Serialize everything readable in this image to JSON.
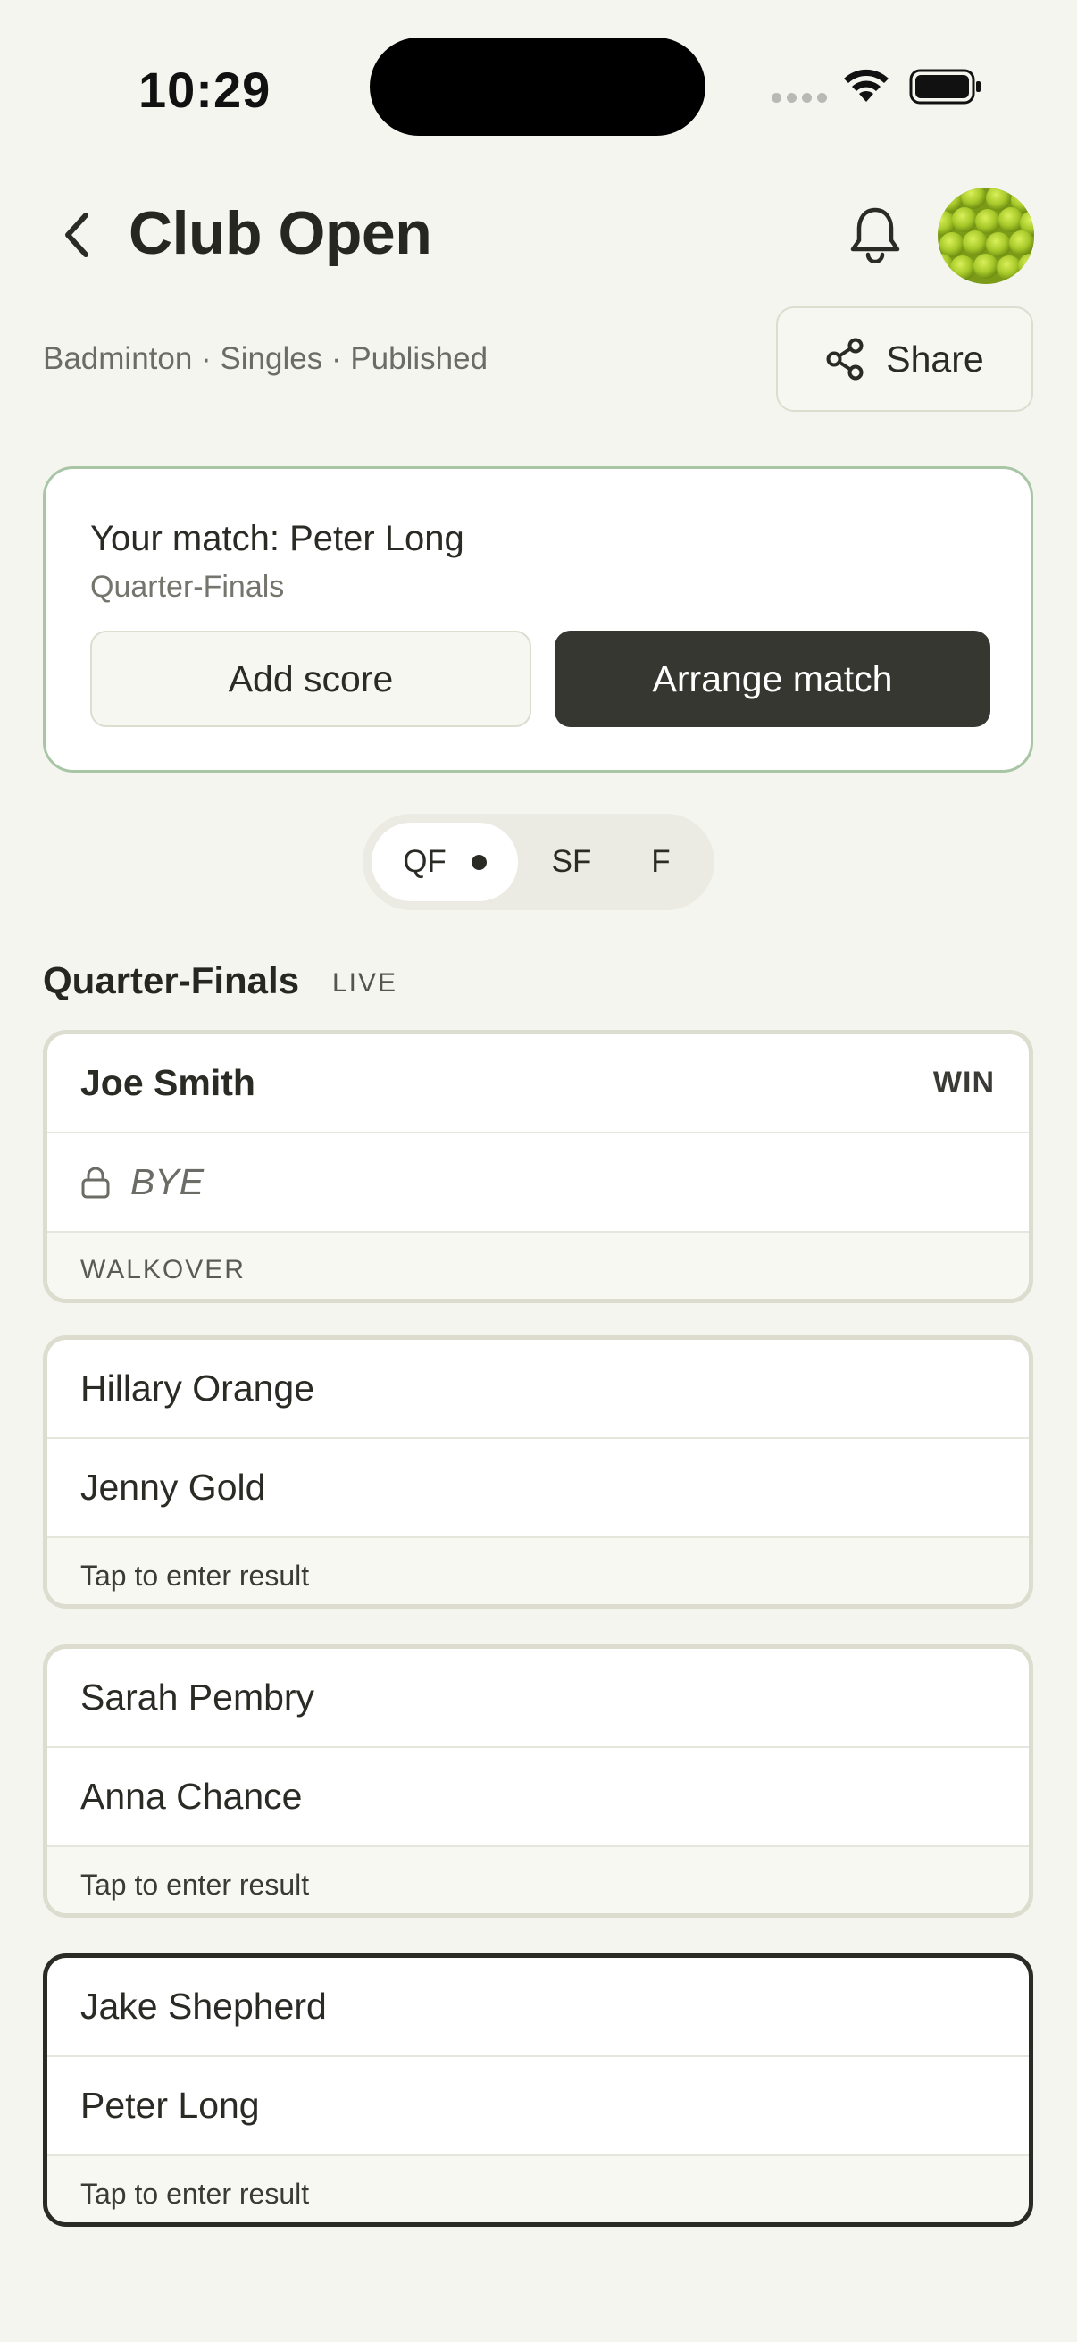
{
  "status_bar": {
    "time": "10:29"
  },
  "header": {
    "title": "Club Open",
    "meta": "Badminton · Singles · Published",
    "share_label": "Share"
  },
  "your_match": {
    "title": "Your match: Peter Long",
    "round": "Quarter-Finals",
    "add_score_label": "Add score",
    "arrange_label": "Arrange match"
  },
  "rounds_tabs": [
    {
      "label": "QF",
      "selected": true,
      "has_dot": true
    },
    {
      "label": "SF",
      "selected": false
    },
    {
      "label": "F",
      "selected": false
    }
  ],
  "section": {
    "title": "Quarter-Finals",
    "badge": "LIVE"
  },
  "matches": [
    {
      "player1": "Joe Smith",
      "player1_result": "WIN",
      "player2": "BYE",
      "footer": "WALKOVER"
    },
    {
      "player1": "Hillary Orange",
      "player2": "Jenny Gold",
      "footer": "Tap to enter result"
    },
    {
      "player1": "Sarah Pembry",
      "player2": "Anna Chance",
      "footer": "Tap to enter result"
    },
    {
      "player1": "Jake Shepherd",
      "player2": "Peter Long",
      "footer": "Tap to enter result",
      "is_user_match": true
    }
  ],
  "colors": {
    "background": "#f5f5f0",
    "accent_dark": "#373731",
    "card_border": "#dcdccf",
    "highlight_border": "#a8c5a6"
  }
}
